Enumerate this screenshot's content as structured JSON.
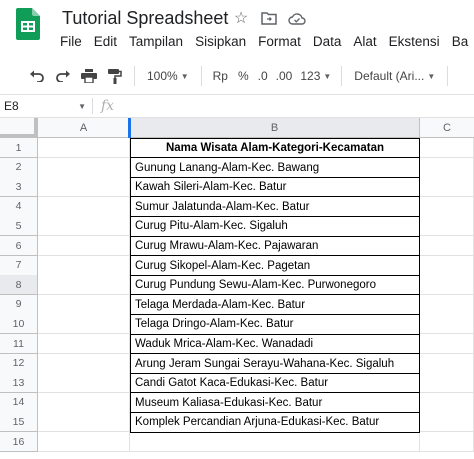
{
  "app": {
    "title": "Tutorial Spreadsheet",
    "brand_color": "#0f9d58"
  },
  "menu": [
    "File",
    "Edit",
    "Tampilan",
    "Sisipkan",
    "Format",
    "Data",
    "Alat",
    "Ekstensi",
    "Ba"
  ],
  "toolbar": {
    "zoom": "100%",
    "currency": "Rp",
    "percent": "%",
    "decrease_decimal": ".0",
    "increase_decimal": ".00",
    "more_formats": "123",
    "font": "Default (Ari..."
  },
  "formula_bar": {
    "cell_ref": "E8",
    "fx": "fx",
    "value": ""
  },
  "columns": [
    "A",
    "B",
    "C"
  ],
  "rows": [
    "1",
    "2",
    "3",
    "4",
    "5",
    "6",
    "7",
    "8",
    "9",
    "10",
    "11",
    "12",
    "13",
    "14",
    "15",
    "16"
  ],
  "selected_row": "8",
  "sheet": {
    "header": "Nama Wisata Alam-Kategori-Kecamatan",
    "entries": [
      "Gunung Lanang-Alam-Kec. Bawang",
      "Kawah Sileri-Alam-Kec. Batur",
      "Sumur Jalatunda-Alam-Kec. Batur",
      "Curug Pitu-Alam-Kec. Sigaluh",
      "Curug Mrawu-Alam-Kec. Pajawaran",
      "Curug Sikopel-Alam-Kec. Pagetan",
      "Curug Pundung Sewu-Alam-Kec. Purwonegoro",
      "Telaga Merdada-Alam-Kec. Batur",
      "Telaga Dringo-Alam-Kec. Batur",
      "Waduk Mrica-Alam-Kec. Wanadadi",
      "Arung Jeram Sungai Serayu-Wahana-Kec. Sigaluh",
      "Candi Gatot Kaca-Edukasi-Kec. Batur",
      "Museum Kaliasa-Edukasi-Kec. Batur",
      "Komplek Percandian Arjuna-Edukasi-Kec. Batur"
    ]
  }
}
